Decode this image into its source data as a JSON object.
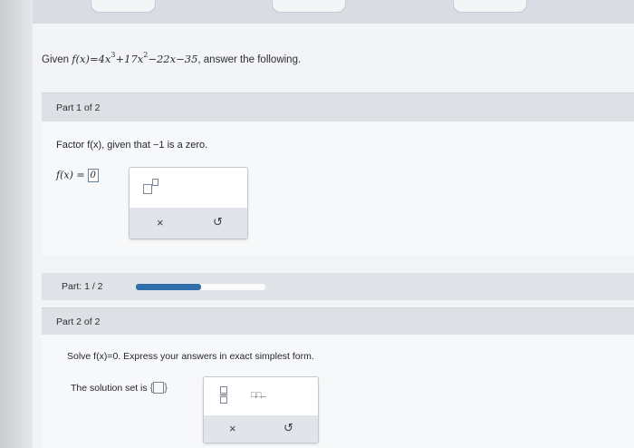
{
  "given": {
    "prefix": "Given",
    "function_expression": "f(x)=4x³+17x²−22x−35",
    "suffix": ", answer the following."
  },
  "part1": {
    "header": "Part 1 of 2",
    "prompt": "Factor f(x), given that −1 is a zero.",
    "answer_lhs": "f(x) =",
    "answer_value": "0",
    "palette": {
      "exponent_tool": "exponent-icon",
      "clear_symbol": "×",
      "undo_symbol": "↺"
    }
  },
  "progress": {
    "label": "Part: 1 / 2",
    "fraction": 0.5,
    "color": "#2f6ea8"
  },
  "part2": {
    "header": "Part 2 of 2",
    "prompt": "Solve f(x)=0. Express your answers in exact simplest form.",
    "solution_label": "The solution set is",
    "palette": {
      "fraction_tool": "fraction-icon",
      "list_tool": "□,□,...",
      "clear_symbol": "×",
      "undo_symbol": "↺"
    }
  }
}
